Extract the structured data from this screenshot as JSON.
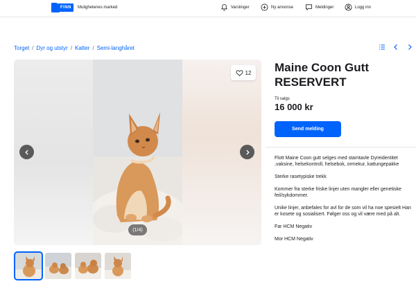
{
  "header": {
    "logo_text": "FINN",
    "tagline": "Mulighetenes marked",
    "nav": [
      {
        "label": "Varslinger",
        "icon": "bell-icon"
      },
      {
        "label": "Ny annonse",
        "icon": "plus-circle-icon"
      },
      {
        "label": "Meldinger",
        "icon": "chat-icon"
      },
      {
        "label": "Logg inn",
        "icon": "user-icon"
      }
    ]
  },
  "breadcrumb": [
    "Torget",
    "Dyr og utstyr",
    "Katter",
    "Semi-langhåret"
  ],
  "breadcrumb_separator": "/",
  "gallery": {
    "favorite_count": "12",
    "counter": "(1/4)",
    "thumbnail_count": 4
  },
  "listing": {
    "title": "Maine Coon Gutt RESERVERT",
    "price_label": "Til salgs",
    "price": "16 000 kr",
    "contact_button": "Send melding"
  },
  "description": [
    "Flott  Maine Coon gutt selges med stamtavle Dyreidentitet ,vaksine, helsekontroll, helsebok, ormekur, kattungepakke",
    "Sterke rasetypiske trekk",
    "",
    "Kommer fra sterke friske linjer uten mangler eller genetiske feil/sykdommer.",
    "Unike linjer, anbefales for avl for de som vil ha noe spesielt Han er kosete og sosialisert. Følger oss og vil være med på alt.",
    "Far HCM  Negativ",
    "Mor HCM  Negativ"
  ],
  "colors": {
    "accent": "#0063fb",
    "text": "#1b1b1f"
  }
}
